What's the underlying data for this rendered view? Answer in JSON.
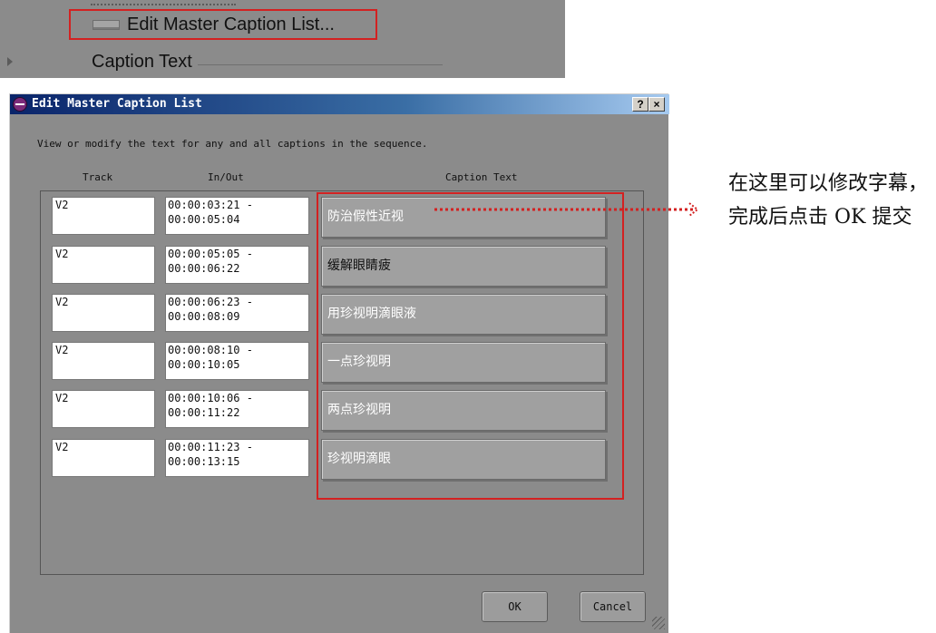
{
  "menu": {
    "edit_item_label": "Edit Master Caption List...",
    "caption_text_label": "Caption Text"
  },
  "dialog": {
    "title": "Edit Master Caption List",
    "help_label": "?",
    "close_label": "×",
    "description": "View or modify the text for any and all captions in the sequence.",
    "columns": {
      "track": "Track",
      "in_out": "In/Out",
      "caption": "Caption Text"
    },
    "rows": [
      {
        "track": "V2",
        "in_out": "00:00:03:21 -\n00:00:05:04",
        "caption": "防治假性近视"
      },
      {
        "track": "V2",
        "in_out": "00:00:05:05 -\n00:00:06:22",
        "caption": "缓解眼睛疲"
      },
      {
        "track": "V2",
        "in_out": "00:00:06:23 -\n00:00:08:09",
        "caption": "用珍视明滴眼液"
      },
      {
        "track": "V2",
        "in_out": "00:00:08:10 -\n00:00:10:05",
        "caption": "一点珍视明"
      },
      {
        "track": "V2",
        "in_out": "00:00:10:06 -\n00:00:11:22",
        "caption": "两点珍视明"
      },
      {
        "track": "V2",
        "in_out": "00:00:11:23 -\n00:00:13:15",
        "caption": "珍视明滴眼"
      }
    ],
    "ok_label": "OK",
    "cancel_label": "Cancel"
  },
  "annotation": {
    "text": "在这里可以修改字幕，完成后点击 OK 提交"
  },
  "colors": {
    "highlight": "#d32121",
    "panel": "#8b8b8b",
    "caption_field": "#a0a0a0"
  }
}
